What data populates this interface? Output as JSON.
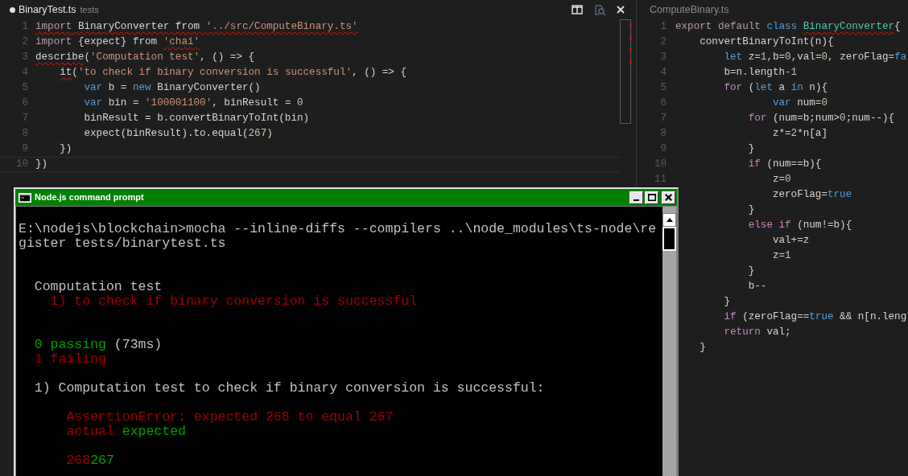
{
  "editors": [
    {
      "tab": {
        "name": "BinaryTest.ts",
        "description": "tests",
        "dirty": true,
        "active": true
      },
      "actions": [
        {
          "kind": "split",
          "disabled": false
        },
        {
          "kind": "preview",
          "disabled": true
        },
        {
          "kind": "close",
          "disabled": false
        }
      ],
      "lines": [
        {
          "number": "1",
          "current": false,
          "tokens": [
            {
              "text": "import",
              "kind": "keyword",
              "error": true
            },
            {
              "text": " BinaryConverter from ",
              "kind": "plain",
              "error": true
            },
            {
              "text": "'../src/ComputeBinary.ts'",
              "kind": "string",
              "error": true
            }
          ]
        },
        {
          "number": "2",
          "current": false,
          "tokens": [
            {
              "text": "import",
              "kind": "keyword",
              "error": false
            },
            {
              "text": " {expect} from ",
              "kind": "plain",
              "error": false
            },
            {
              "text": "'chai'",
              "kind": "string",
              "error": true
            }
          ]
        },
        {
          "number": "3",
          "current": false,
          "tokens": [
            {
              "text": "describe",
              "kind": "plain",
              "error": true
            },
            {
              "text": "(",
              "kind": "plain",
              "error": false
            },
            {
              "text": "'Computation test'",
              "kind": "string",
              "error": false
            },
            {
              "text": ", () => {",
              "kind": "plain",
              "error": false
            }
          ]
        },
        {
          "number": "4",
          "current": false,
          "tokens": [
            {
              "text": "    it",
              "kind": "plain",
              "error": true
            },
            {
              "text": "(",
              "kind": "plain",
              "error": false
            },
            {
              "text": "'to check if binary conversion is successful'",
              "kind": "string",
              "error": false
            },
            {
              "text": ", () => {",
              "kind": "plain",
              "error": false
            }
          ]
        },
        {
          "number": "5",
          "current": false,
          "tokens": [
            {
              "text": "        var",
              "kind": "storage",
              "error": false
            },
            {
              "text": " b = ",
              "kind": "plain",
              "error": false
            },
            {
              "text": "new",
              "kind": "storage",
              "error": false
            },
            {
              "text": " BinaryConverter()",
              "kind": "plain",
              "error": false
            }
          ]
        },
        {
          "number": "6",
          "current": false,
          "tokens": [
            {
              "text": "        var",
              "kind": "storage",
              "error": false
            },
            {
              "text": " bin = ",
              "kind": "plain",
              "error": false
            },
            {
              "text": "'100001100'",
              "kind": "string",
              "error": false
            },
            {
              "text": ", binResult = ",
              "kind": "plain",
              "error": false
            },
            {
              "text": "0",
              "kind": "number",
              "error": false
            }
          ]
        },
        {
          "number": "7",
          "current": false,
          "tokens": [
            {
              "text": "        binResult = b.convertBinaryToInt(bin)",
              "kind": "plain",
              "error": false
            }
          ]
        },
        {
          "number": "8",
          "current": false,
          "tokens": [
            {
              "text": "        expect(binResult).to.equal(",
              "kind": "plain",
              "error": false
            },
            {
              "text": "267",
              "kind": "number",
              "error": false
            },
            {
              "text": ")",
              "kind": "plain",
              "error": false
            }
          ]
        },
        {
          "number": "9",
          "current": false,
          "tokens": [
            {
              "text": "    })",
              "kind": "plain",
              "error": false
            }
          ]
        },
        {
          "number": "10",
          "current": true,
          "tokens": [
            {
              "text": "})",
              "kind": "plain",
              "error": false
            }
          ]
        }
      ]
    },
    {
      "tab": {
        "name": "ComputeBinary.ts",
        "dirty": false,
        "active": false
      },
      "lines": [
        {
          "number": "1",
          "tokens": [
            {
              "text": "export default ",
              "kind": "keyword",
              "error": false
            },
            {
              "text": "class ",
              "kind": "storage",
              "error": false
            },
            {
              "text": "BinaryConverter",
              "kind": "type",
              "error": true
            },
            {
              "text": "{",
              "kind": "plain",
              "error": false
            }
          ]
        },
        {
          "number": "2",
          "tokens": [
            {
              "text": "    convertBinaryToInt(n){",
              "kind": "plain",
              "error": false
            }
          ]
        },
        {
          "number": "3",
          "tokens": [
            {
              "text": "        let",
              "kind": "storage",
              "error": false
            },
            {
              "text": " z=",
              "kind": "plain",
              "error": false
            },
            {
              "text": "1",
              "kind": "number",
              "error": false
            },
            {
              "text": ",b=",
              "kind": "plain",
              "error": false
            },
            {
              "text": "0",
              "kind": "number",
              "error": false
            },
            {
              "text": ",val=",
              "kind": "plain",
              "error": false
            },
            {
              "text": "0",
              "kind": "number",
              "error": false
            },
            {
              "text": ", zeroFlag=",
              "kind": "plain",
              "error": false
            },
            {
              "text": "fa",
              "kind": "storage",
              "error": false
            }
          ]
        },
        {
          "number": "4",
          "tokens": [
            {
              "text": "        b=n.length-",
              "kind": "plain",
              "error": false
            },
            {
              "text": "1",
              "kind": "number",
              "error": false
            }
          ]
        },
        {
          "number": "5",
          "tokens": [
            {
              "text": "        for",
              "kind": "control",
              "error": false
            },
            {
              "text": " (",
              "kind": "plain",
              "error": false
            },
            {
              "text": "let",
              "kind": "storage",
              "error": false
            },
            {
              "text": " a ",
              "kind": "plain",
              "error": false
            },
            {
              "text": "in",
              "kind": "storage",
              "error": false
            },
            {
              "text": " n){",
              "kind": "plain",
              "error": false
            }
          ]
        },
        {
          "number": "6",
          "tokens": [
            {
              "text": "                var",
              "kind": "storage",
              "error": false
            },
            {
              "text": " num=",
              "kind": "plain",
              "error": false
            },
            {
              "text": "0",
              "kind": "number",
              "error": false
            }
          ]
        },
        {
          "number": "7",
          "tokens": [
            {
              "text": "            for",
              "kind": "control",
              "error": false
            },
            {
              "text": " (num=b;num>",
              "kind": "plain",
              "error": false
            },
            {
              "text": "0",
              "kind": "number",
              "error": false
            },
            {
              "text": ";num--){",
              "kind": "plain",
              "error": false
            }
          ]
        },
        {
          "number": "8",
          "tokens": [
            {
              "text": "                z*=",
              "kind": "plain",
              "error": false
            },
            {
              "text": "2",
              "kind": "number",
              "error": false
            },
            {
              "text": "*n[a]",
              "kind": "plain",
              "error": false
            }
          ]
        },
        {
          "number": "9",
          "tokens": [
            {
              "text": "            }",
              "kind": "plain",
              "error": false
            }
          ]
        },
        {
          "number": "10",
          "tokens": [
            {
              "text": "            if",
              "kind": "control",
              "error": false
            },
            {
              "text": " (num==b){",
              "kind": "plain",
              "error": false
            }
          ]
        },
        {
          "number": "11",
          "tokens": [
            {
              "text": "                z=",
              "kind": "plain",
              "error": false
            },
            {
              "text": "0",
              "kind": "number",
              "error": false
            }
          ]
        },
        {
          "tokens": [
            {
              "text": "                zeroFlag=",
              "kind": "plain",
              "error": false
            },
            {
              "text": "true",
              "kind": "storage",
              "error": false
            }
          ]
        },
        {
          "tokens": [
            {
              "text": "            }",
              "kind": "plain",
              "error": false
            }
          ]
        },
        {
          "tokens": [
            {
              "text": "            else if",
              "kind": "control",
              "error": false
            },
            {
              "text": " (num!=b){",
              "kind": "plain",
              "error": false
            }
          ]
        },
        {
          "tokens": [
            {
              "text": "                val+=z",
              "kind": "plain",
              "error": false
            }
          ]
        },
        {
          "tokens": [
            {
              "text": "                z=",
              "kind": "plain",
              "error": false
            },
            {
              "text": "1",
              "kind": "number",
              "error": false
            }
          ]
        },
        {
          "tokens": [
            {
              "text": "            }",
              "kind": "plain",
              "error": false
            }
          ]
        },
        {
          "tokens": [
            {
              "text": "            b--",
              "kind": "plain",
              "error": false
            }
          ]
        },
        {
          "tokens": [
            {
              "text": "        }",
              "kind": "plain",
              "error": false
            }
          ]
        },
        {
          "tokens": [
            {
              "text": "        if",
              "kind": "control",
              "error": false
            },
            {
              "text": " (zeroFlag==",
              "kind": "plain",
              "error": false
            },
            {
              "text": "true",
              "kind": "storage",
              "error": false
            },
            {
              "text": " && n[n.leng",
              "kind": "plain",
              "error": false
            }
          ]
        },
        {
          "tokens": [
            {
              "text": "        return",
              "kind": "control",
              "error": false
            },
            {
              "text": " val;",
              "kind": "plain",
              "error": false
            }
          ]
        },
        {
          "tokens": [
            {
              "text": "    }",
              "kind": "plain",
              "error": false
            }
          ]
        }
      ]
    }
  ],
  "terminal": {
    "title": "Node.js command prompt",
    "lines": [
      {
        "kind": "blank"
      },
      {
        "kind": "text",
        "spans": [
          {
            "text": "E:\\nodejs\\blockchain>mocha --inline-diffs --compilers ..\\node_modules\\ts-node\\re",
            "color": "#c0c0c0"
          }
        ]
      },
      {
        "kind": "text",
        "spans": [
          {
            "text": "gister tests/binarytest.ts",
            "color": "#c0c0c0"
          }
        ]
      },
      {
        "kind": "blank"
      },
      {
        "kind": "blank"
      },
      {
        "kind": "text",
        "spans": [
          {
            "text": "  Computation test",
            "color": "#c0c0c0"
          }
        ]
      },
      {
        "kind": "text",
        "spans": [
          {
            "text": "    1) to check if binary conversion is successful",
            "color": "#a00000"
          }
        ]
      },
      {
        "kind": "blank"
      },
      {
        "kind": "blank"
      },
      {
        "kind": "text",
        "spans": [
          {
            "text": "  0 passing",
            "color": "#00a000"
          },
          {
            "text": " (73ms)",
            "color": "#c0c0c0"
          }
        ]
      },
      {
        "kind": "text",
        "spans": [
          {
            "text": "  1 failing",
            "color": "#a00000"
          }
        ]
      },
      {
        "kind": "blank"
      },
      {
        "kind": "text",
        "spans": [
          {
            "text": "  1) Computation test to check if binary conversion is successful:",
            "color": "#c0c0c0"
          }
        ]
      },
      {
        "kind": "blank"
      },
      {
        "kind": "text",
        "spans": [
          {
            "text": "      AssertionError: expected 268 to equal 267",
            "color": "#a00000"
          }
        ]
      },
      {
        "kind": "text",
        "spans": [
          {
            "text": "      actual",
            "color": "#a00000"
          },
          {
            "text": " expected",
            "color": "#00a000"
          }
        ]
      },
      {
        "kind": "blank"
      },
      {
        "kind": "text",
        "spans": [
          {
            "text": "      268",
            "color": "#a00000"
          },
          {
            "text": "267",
            "color": "#00a000"
          }
        ]
      }
    ]
  }
}
